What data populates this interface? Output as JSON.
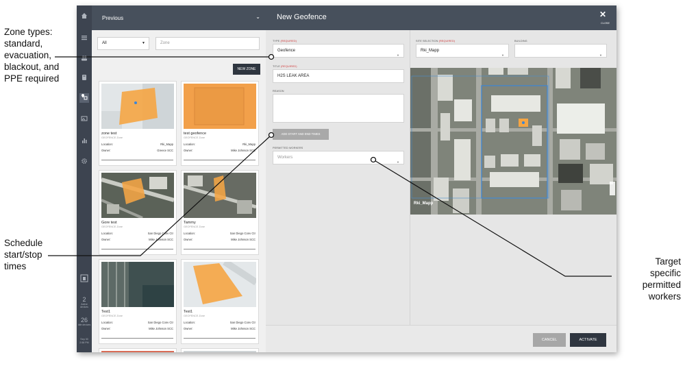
{
  "callouts": {
    "zone_types": [
      "Zone types:",
      "standard,",
      "evacuation,",
      "blackout, and",
      "PPE required"
    ],
    "schedule": [
      "Schedule",
      "start/stop",
      "times"
    ],
    "target": [
      "Target",
      "specific",
      "permitted",
      "workers"
    ]
  },
  "rail": {
    "icons": [
      "home-icon",
      "list-icon",
      "people-icon",
      "badge-icon",
      "geofence-icon",
      "image-icon",
      "chart-icon",
      "gear-icon"
    ],
    "active_icon": "geofence-icon",
    "stats": [
      {
        "value": "2",
        "label": "Active devices"
      },
      {
        "value": "26",
        "label": "Idle devices"
      }
    ],
    "time": [
      "Sep 30",
      "2:58 PM"
    ]
  },
  "list": {
    "header": "Previous",
    "filter_value": "All",
    "search_placeholder": "Zone",
    "new_zone_label": "NEW ZONE",
    "location_label": "Location:",
    "owner_label": "Owner:",
    "cards": [
      {
        "name": "zone test",
        "type": "GEOFENCE Zone",
        "location": "Rki_Mapp",
        "owner": "Greece SCC"
      },
      {
        "name": "test geofence",
        "type": "GEOFENCE Zone",
        "location": "Rki_Mapp",
        "owner": "Mike Johnson SCC"
      },
      {
        "name": "Gore test",
        "type": "GEOFENCE Zone",
        "location": "San Diego Conv Ctr",
        "owner": "Mike Johnson SCC"
      },
      {
        "name": "Tammy",
        "type": "GEOFENCE Zone",
        "location": "San Diego Conv Ctr",
        "owner": "Mike Johnson SCC"
      },
      {
        "name": "Test1",
        "type": "GEOFENCE Zone",
        "location": "San Diego Conv Ctr",
        "owner": "Mike Johnson SCC"
      },
      {
        "name": "Test1",
        "type": "GEOFENCE Zone",
        "location": "San Diego Conv Ctr",
        "owner": "Mike Johnson SCC"
      }
    ]
  },
  "form": {
    "title": "New Geofence",
    "close_label": "CLOSE",
    "required_tag": "(REQUIRED)",
    "type_label": "TYPE",
    "type_value": "Geofence",
    "title_label": "TITLE",
    "title_value": "H2S LEAK AREA",
    "reason_label": "REASON",
    "add_times_label": "ADD START AND END TIMES",
    "workers_label": "PERMITTED WORKERS",
    "workers_placeholder": "Workers",
    "site_label": "SITE SELECTION",
    "site_value": "Rki_Mapp",
    "building_label": "BUILDING",
    "map_label": "Rki_Mapp",
    "cancel_label": "CANCEL",
    "activate_label": "ACTIVATE"
  },
  "colors": {
    "header": "#47505c",
    "rail": "#3d4450",
    "zone_fill": "#f5a544",
    "required": "#d13b3b",
    "primary_button": "#2f3640"
  }
}
